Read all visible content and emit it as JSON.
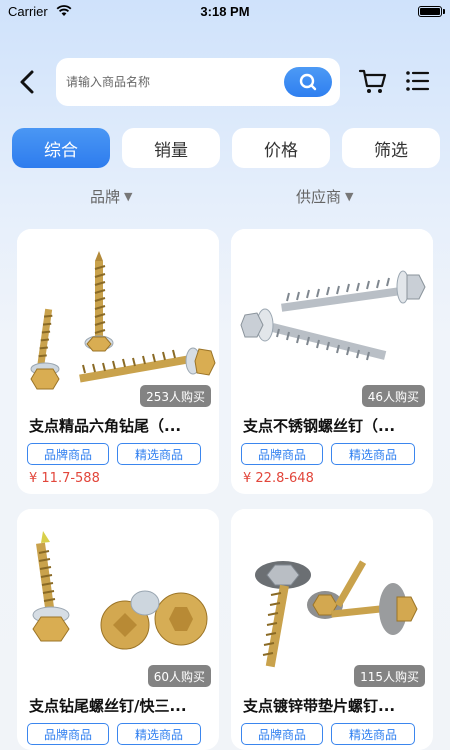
{
  "status_bar": {
    "carrier": "Carrier",
    "time": "3:18 PM"
  },
  "search": {
    "placeholder": "请输入商品名称",
    "value": ""
  },
  "icons": {
    "back": "chevron-left-icon",
    "search": "search-icon",
    "cart": "cart-icon",
    "menu": "list-icon"
  },
  "colors": {
    "accent": "#2f7ff0",
    "price": "#e2463b"
  },
  "tabs": [
    {
      "label": "综合",
      "active": true
    },
    {
      "label": "销量",
      "active": false
    },
    {
      "label": "价格",
      "active": false
    },
    {
      "label": "筛选",
      "active": false
    }
  ],
  "filters": [
    {
      "label": "品牌",
      "caret": "▼"
    },
    {
      "label": "供应商",
      "caret": "▼"
    }
  ],
  "products": [
    {
      "name": "支点精品六角钻尾（...",
      "buyers": "253人购买",
      "tags": [
        "品牌商品",
        "精选商品"
      ],
      "price": "¥ 11.7-588"
    },
    {
      "name": "支点不锈钢螺丝钉（...",
      "buyers": "46人购买",
      "tags": [
        "品牌商品",
        "精选商品"
      ],
      "price": "¥ 22.8-648"
    },
    {
      "name": "支点钻尾螺丝钉/快三...",
      "buyers": "60人购买",
      "tags": [
        "品牌商品",
        "精选商品"
      ],
      "price": ""
    },
    {
      "name": "支点镀锌带垫片螺钉...",
      "buyers": "115人购买",
      "tags": [
        "品牌商品",
        "精选商品"
      ],
      "price": ""
    }
  ]
}
